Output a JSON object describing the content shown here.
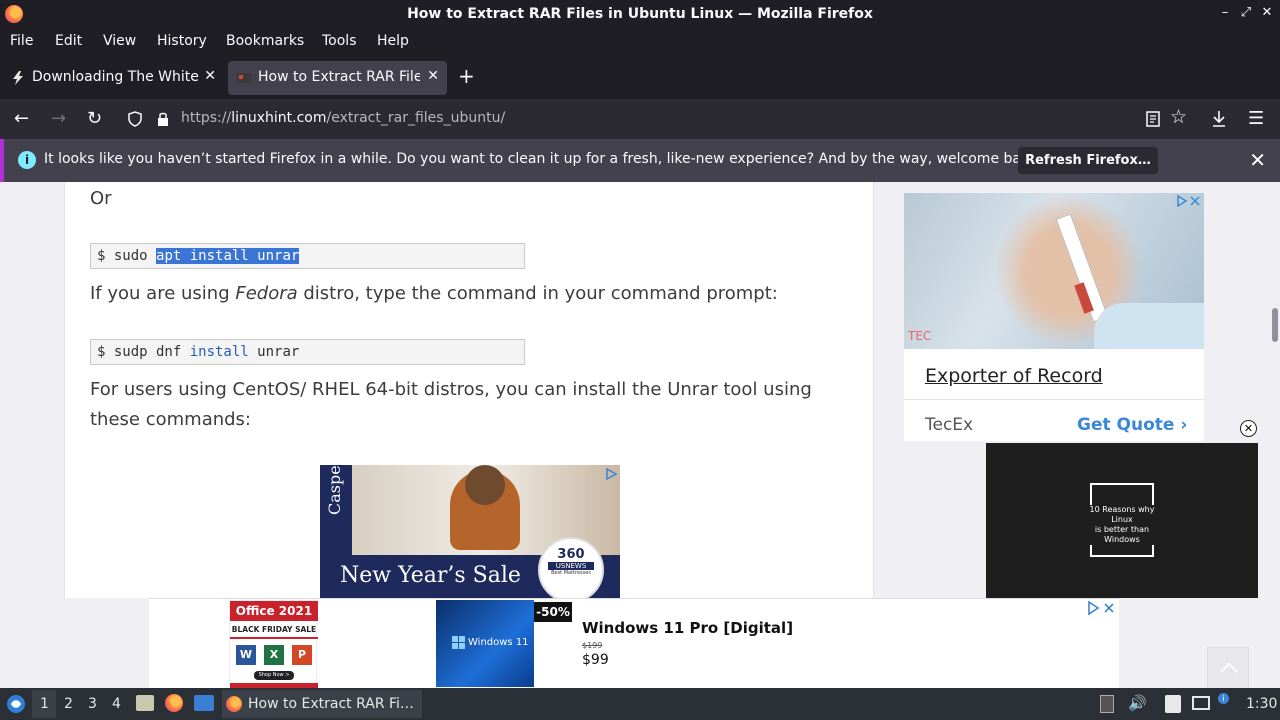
{
  "window": {
    "title": "How to Extract RAR Files in Ubuntu Linux — Mozilla Firefox",
    "controls": [
      "–",
      "⤢",
      "✕"
    ]
  },
  "menu": [
    "File",
    "Edit",
    "View",
    "History",
    "Bookmarks",
    "Tools",
    "Help"
  ],
  "tabs": [
    {
      "label": "Downloading The White I",
      "active": false
    },
    {
      "label": "How to Extract RAR Files",
      "active": true
    }
  ],
  "new_tab_label": "+",
  "nav": {
    "url_prefix": "https://",
    "url_domain": "linuxhint.com",
    "url_path": "/extract_rar_files_ubuntu/"
  },
  "notification": {
    "message": "It looks like you haven’t started Firefox in a while. Do you want to clean it up for a fresh, like-new experience? And by the way, welcome back!",
    "button": "Refresh Firefox…"
  },
  "article": {
    "or_text": "Or",
    "code1": {
      "prompt": "$ sudo ",
      "selected": "apt install unrar"
    },
    "fedora_pre": "If you are using ",
    "fedora_em": "Fedora",
    "fedora_post": " distro, type the command in your command prompt:",
    "code2": {
      "prompt": "$ sudp dnf ",
      "keyword": "install",
      "rest": " unrar"
    },
    "centos_line1": "For users using CentOS/ RHEL 64-bit distros, you can install the Unrar tool using",
    "centos_line2": "these commands:",
    "ad": {
      "brand": "Casper",
      "headline": "New Year’s Sale",
      "badge_top": "360",
      "badge_mid": "USNEWS",
      "badge_bot": "Best Mattresses"
    }
  },
  "sidebar_ad": {
    "title": "Exporter of Record",
    "advertiser": "TecEx",
    "cta": "Get Quote",
    "watermark": "TEC"
  },
  "video": {
    "line1": "10 Reasons why Linux",
    "line2": "is better than",
    "line3": "Windows"
  },
  "bottom_ad": {
    "office_title": "Office 2021",
    "office_sub": "BLACK FRIDAY SALE",
    "office_btn": "Shop Now >",
    "discount": "-50%",
    "win_badge": "Windows 11",
    "product": "Windows 11 Pro [Digital]",
    "old_price": "$199",
    "price": "$99"
  },
  "taskbar": {
    "workspaces": [
      "1",
      "2",
      "3",
      "4"
    ],
    "task_label": "How to Extract RAR Fi…",
    "clock": "1:30"
  },
  "colors": {
    "accent": "#b62fd6",
    "link_blue": "#3a86d8",
    "selection": "#3a75d6"
  }
}
